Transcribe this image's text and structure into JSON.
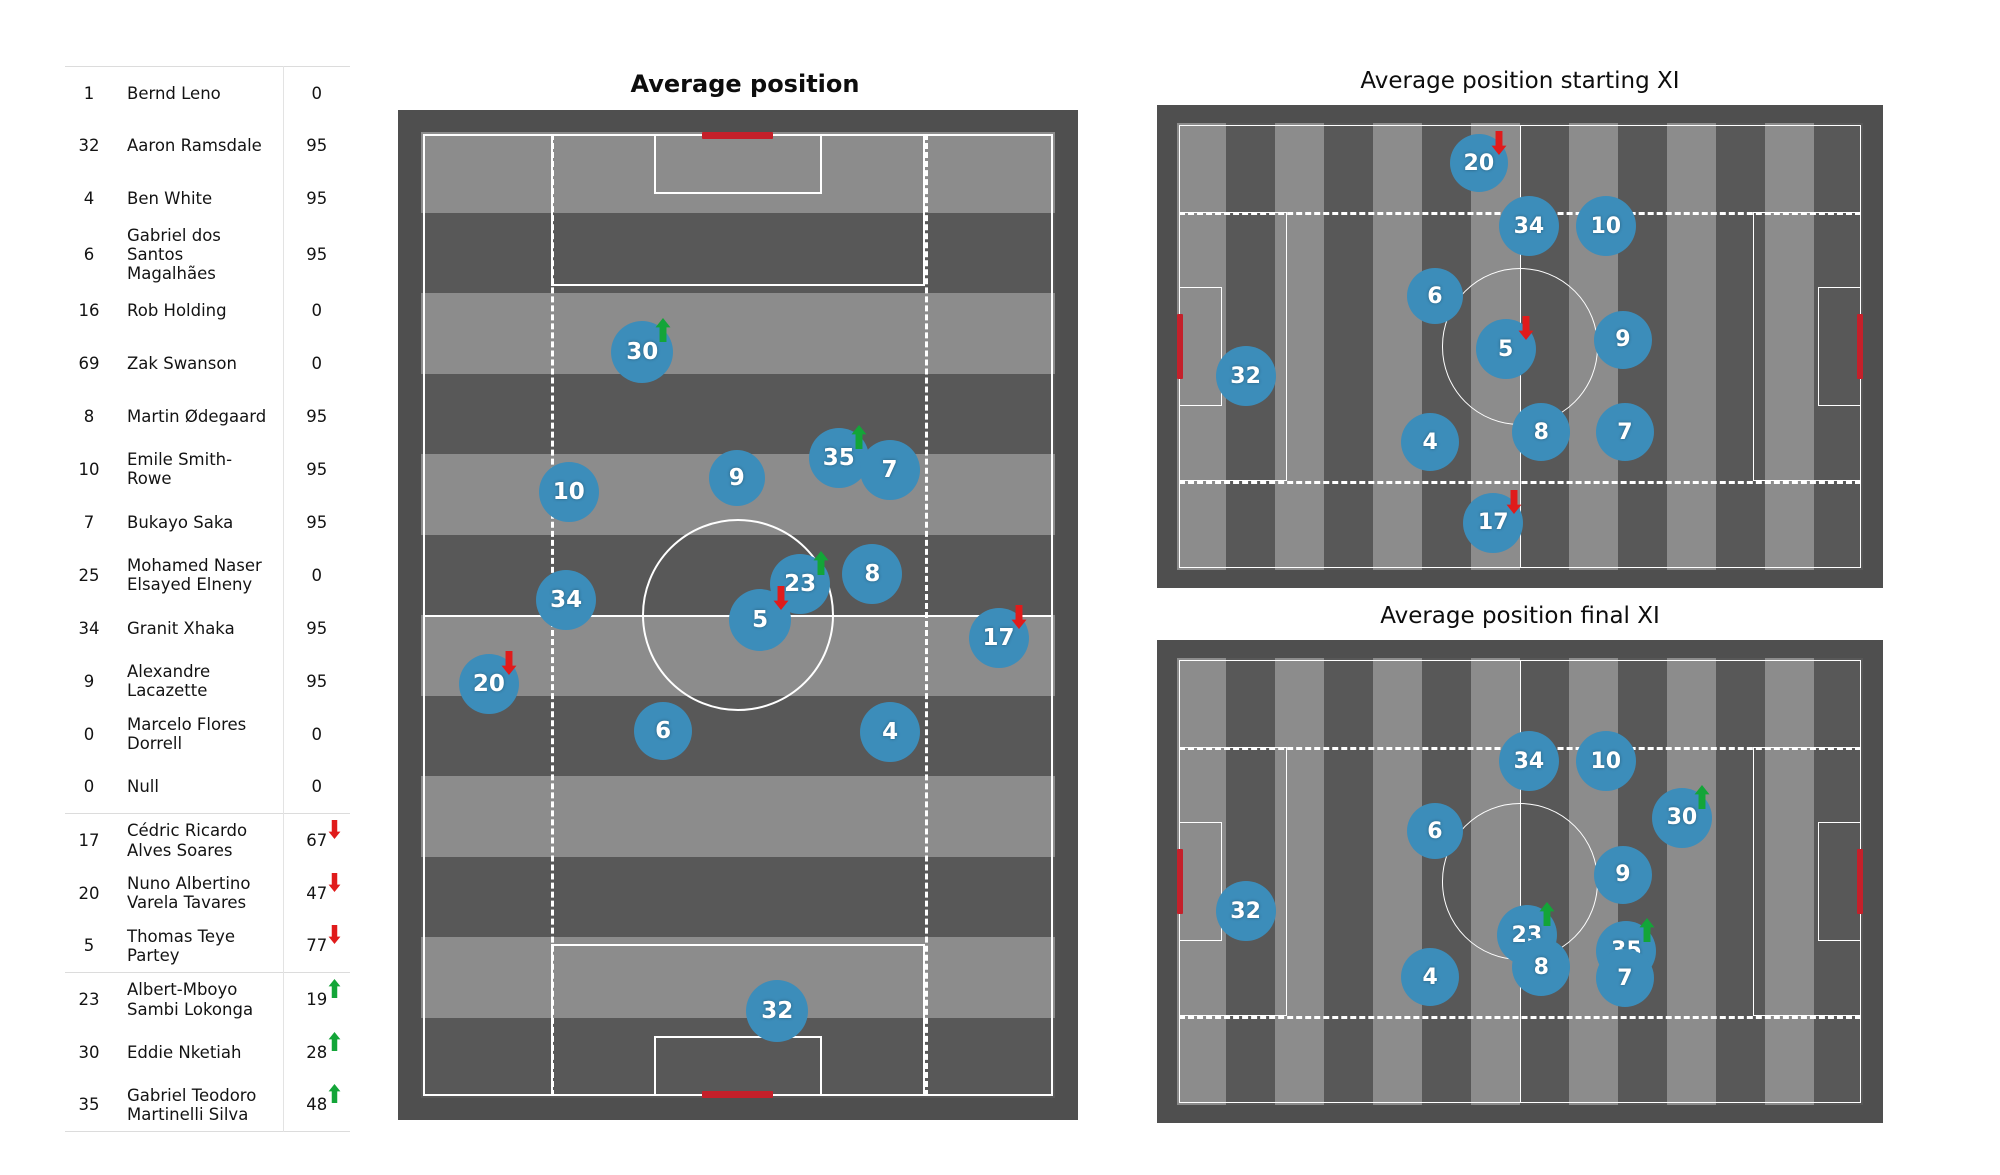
{
  "roster": {
    "groups": [
      {
        "name": "squad",
        "rows": [
          {
            "number": "1",
            "name": "Bernd Leno",
            "minutes": "0",
            "arrow": "none"
          },
          {
            "number": "32",
            "name": "Aaron Ramsdale",
            "minutes": "95",
            "arrow": "none"
          },
          {
            "number": "4",
            "name": "Ben White",
            "minutes": "95",
            "arrow": "none"
          },
          {
            "number": "6",
            "name": "Gabriel dos Santos Magalhães",
            "minutes": "95",
            "arrow": "none"
          },
          {
            "number": "16",
            "name": "Rob Holding",
            "minutes": "0",
            "arrow": "none"
          },
          {
            "number": "69",
            "name": "Zak Swanson",
            "minutes": "0",
            "arrow": "none"
          },
          {
            "number": "8",
            "name": "Martin Ødegaard",
            "minutes": "95",
            "arrow": "none"
          },
          {
            "number": "10",
            "name": "Emile Smith-Rowe",
            "minutes": "95",
            "arrow": "none"
          },
          {
            "number": "7",
            "name": "Bukayo Saka",
            "minutes": "95",
            "arrow": "none"
          },
          {
            "number": "25",
            "name": "Mohamed Naser Elsayed Elneny",
            "minutes": "0",
            "arrow": "none"
          },
          {
            "number": "34",
            "name": "Granit Xhaka",
            "minutes": "95",
            "arrow": "none"
          },
          {
            "number": "9",
            "name": "Alexandre Lacazette",
            "minutes": "95",
            "arrow": "none"
          },
          {
            "number": "0",
            "name": "Marcelo Flores Dorrell",
            "minutes": "0",
            "arrow": "none"
          },
          {
            "number": "0",
            "name": "Null",
            "minutes": "0",
            "arrow": "none"
          }
        ]
      },
      {
        "name": "subbed-off",
        "rows": [
          {
            "number": "17",
            "name": "Cédric Ricardo Alves Soares",
            "minutes": "67",
            "arrow": "down"
          },
          {
            "number": "20",
            "name": "Nuno Albertino Varela Tavares",
            "minutes": "47",
            "arrow": "down"
          },
          {
            "number": "5",
            "name": "Thomas Teye Partey",
            "minutes": "77",
            "arrow": "down"
          }
        ]
      },
      {
        "name": "subbed-on",
        "rows": [
          {
            "number": "23",
            "name": "Albert-Mboyo Sambi Lokonga",
            "minutes": "19",
            "arrow": "up"
          },
          {
            "number": "30",
            "name": "Eddie Nketiah",
            "minutes": "28",
            "arrow": "up"
          },
          {
            "number": "35",
            "name": "Gabriel Teodoro Martinelli Silva",
            "minutes": "48",
            "arrow": "up"
          }
        ]
      }
    ]
  },
  "colors": {
    "marker_blue": "#3c8dba",
    "pitch_border": "#4f4f4f",
    "stripe_light": "#8c8c8c",
    "stripe_dark": "#585858",
    "goal_red": "#c4202a",
    "arrow_up_green": "#13a538",
    "arrow_down_red": "#e01b1b",
    "text": "#131313"
  },
  "panels": {
    "main": {
      "title": "Average position",
      "orientation": "vertical",
      "markers": [
        {
          "label": "30",
          "x": 0.349,
          "y": 0.228,
          "r": 31,
          "arrow": "up"
        },
        {
          "label": "9",
          "x": 0.498,
          "y": 0.358,
          "r": 28,
          "arrow": "none"
        },
        {
          "label": "35",
          "x": 0.659,
          "y": 0.337,
          "r": 30,
          "arrow": "up"
        },
        {
          "label": "7",
          "x": 0.739,
          "y": 0.35,
          "r": 30,
          "arrow": "none"
        },
        {
          "label": "10",
          "x": 0.233,
          "y": 0.373,
          "r": 30,
          "arrow": "none"
        },
        {
          "label": "34",
          "x": 0.229,
          "y": 0.484,
          "r": 30,
          "arrow": "none"
        },
        {
          "label": "23",
          "x": 0.598,
          "y": 0.468,
          "r": 30,
          "arrow": "up"
        },
        {
          "label": "8",
          "x": 0.712,
          "y": 0.458,
          "r": 30,
          "arrow": "none"
        },
        {
          "label": "5",
          "x": 0.535,
          "y": 0.505,
          "r": 31,
          "arrow": "down"
        },
        {
          "label": "17",
          "x": 0.911,
          "y": 0.524,
          "r": 30,
          "arrow": "down"
        },
        {
          "label": "20",
          "x": 0.107,
          "y": 0.571,
          "r": 30,
          "arrow": "down"
        },
        {
          "label": "6",
          "x": 0.382,
          "y": 0.62,
          "r": 29,
          "arrow": "none"
        },
        {
          "label": "4",
          "x": 0.74,
          "y": 0.621,
          "r": 30,
          "arrow": "none"
        },
        {
          "label": "32",
          "x": 0.562,
          "y": 0.91,
          "r": 31,
          "arrow": "none"
        }
      ]
    },
    "starting": {
      "title": "Average position starting XI",
      "orientation": "horizontal",
      "markers": [
        {
          "label": "20",
          "x": 0.44,
          "y": 0.09,
          "r": 29,
          "arrow": "down"
        },
        {
          "label": "34",
          "x": 0.513,
          "y": 0.231,
          "r": 30,
          "arrow": "none"
        },
        {
          "label": "10",
          "x": 0.625,
          "y": 0.231,
          "r": 30,
          "arrow": "none"
        },
        {
          "label": "6",
          "x": 0.376,
          "y": 0.388,
          "r": 28,
          "arrow": "none"
        },
        {
          "label": "5",
          "x": 0.479,
          "y": 0.506,
          "r": 30,
          "arrow": "down"
        },
        {
          "label": "9",
          "x": 0.65,
          "y": 0.485,
          "r": 29,
          "arrow": "none"
        },
        {
          "label": "32",
          "x": 0.1,
          "y": 0.567,
          "r": 30,
          "arrow": "none"
        },
        {
          "label": "8",
          "x": 0.531,
          "y": 0.692,
          "r": 29,
          "arrow": "none"
        },
        {
          "label": "7",
          "x": 0.653,
          "y": 0.692,
          "r": 29,
          "arrow": "none"
        },
        {
          "label": "4",
          "x": 0.369,
          "y": 0.714,
          "r": 29,
          "arrow": "none"
        },
        {
          "label": "17",
          "x": 0.461,
          "y": 0.894,
          "r": 30,
          "arrow": "down"
        }
      ]
    },
    "final": {
      "title": "Average position final XI",
      "orientation": "horizontal",
      "markers": [
        {
          "label": "34",
          "x": 0.513,
          "y": 0.231,
          "r": 30,
          "arrow": "none"
        },
        {
          "label": "10",
          "x": 0.625,
          "y": 0.231,
          "r": 30,
          "arrow": "none"
        },
        {
          "label": "30",
          "x": 0.736,
          "y": 0.357,
          "r": 30,
          "arrow": "up"
        },
        {
          "label": "6",
          "x": 0.376,
          "y": 0.388,
          "r": 28,
          "arrow": "none"
        },
        {
          "label": "9",
          "x": 0.65,
          "y": 0.485,
          "r": 29,
          "arrow": "none"
        },
        {
          "label": "32",
          "x": 0.1,
          "y": 0.567,
          "r": 30,
          "arrow": "none"
        },
        {
          "label": "23",
          "x": 0.51,
          "y": 0.62,
          "r": 30,
          "arrow": "up"
        },
        {
          "label": "35",
          "x": 0.655,
          "y": 0.655,
          "r": 30,
          "arrow": "up"
        },
        {
          "label": "8",
          "x": 0.531,
          "y": 0.692,
          "r": 29,
          "arrow": "none"
        },
        {
          "label": "7",
          "x": 0.653,
          "y": 0.716,
          "r": 29,
          "arrow": "none"
        },
        {
          "label": "4",
          "x": 0.369,
          "y": 0.714,
          "r": 29,
          "arrow": "none"
        }
      ]
    }
  }
}
